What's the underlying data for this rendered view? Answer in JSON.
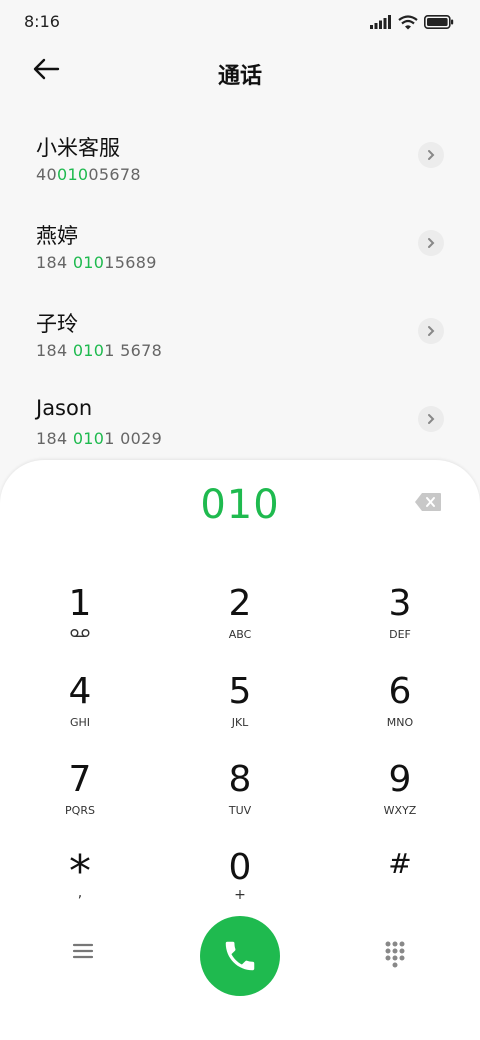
{
  "status": {
    "time": "8:16"
  },
  "header": {
    "title": "通话"
  },
  "contacts": [
    {
      "name": "小米客服",
      "num_pre": "40",
      "num_hl": "010",
      "num_post": "05678"
    },
    {
      "name": "燕婷",
      "num_pre": "184 ",
      "num_hl": "010",
      "num_post": "15689"
    },
    {
      "name": "子玲",
      "num_pre": "184 ",
      "num_hl": "010",
      "num_post": "1 5678"
    },
    {
      "name": "Jason",
      "num_pre": "184 ",
      "num_hl": "010",
      "num_post": "1 0029"
    }
  ],
  "dialpad": {
    "entered": "010",
    "keys": [
      {
        "digit": "1",
        "letters": ""
      },
      {
        "digit": "2",
        "letters": "ABC"
      },
      {
        "digit": "3",
        "letters": "DEF"
      },
      {
        "digit": "4",
        "letters": "GHI"
      },
      {
        "digit": "5",
        "letters": "JKL"
      },
      {
        "digit": "6",
        "letters": "MNO"
      },
      {
        "digit": "7",
        "letters": "PQRS"
      },
      {
        "digit": "8",
        "letters": "TUV"
      },
      {
        "digit": "9",
        "letters": "WXYZ"
      },
      {
        "digit": "*",
        "letters": ","
      },
      {
        "digit": "0",
        "letters": "+"
      },
      {
        "digit": "#",
        "letters": ""
      }
    ]
  },
  "colors": {
    "accent": "#1fba4f",
    "background": "#f7f7f7"
  },
  "icons": [
    "signal-icon",
    "wifi-icon",
    "battery-icon",
    "back-arrow-icon",
    "chevron-right-icon",
    "backspace-icon",
    "voicemail-icon",
    "menu-icon",
    "phone-icon",
    "keypad-icon"
  ]
}
